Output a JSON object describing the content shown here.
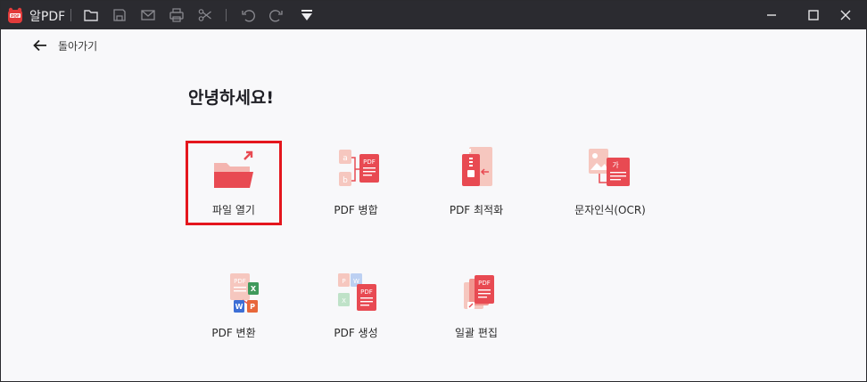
{
  "titlebar": {
    "app_name": "알PDF",
    "toolbar_icons": [
      "folder-icon",
      "save-icon",
      "mail-icon",
      "print-icon",
      "scissors-icon",
      "undo-icon",
      "redo-icon",
      "dropdown-icon"
    ],
    "window_controls": [
      "minimize-icon",
      "maximize-icon",
      "close-icon"
    ]
  },
  "back": {
    "label": "돌아가기"
  },
  "greeting": "안녕하세요!",
  "tiles": [
    {
      "label": "파일 열기",
      "icon": "open-file-icon"
    },
    {
      "label": "PDF 병합",
      "icon": "pdf-merge-icon"
    },
    {
      "label": "PDF 최적화",
      "icon": "pdf-optimize-icon"
    },
    {
      "label": "문자인식(OCR)",
      "icon": "ocr-icon"
    },
    {
      "label": "PDF 변환",
      "icon": "pdf-convert-icon"
    },
    {
      "label": "PDF 생성",
      "icon": "pdf-create-icon"
    },
    {
      "label": "일괄 편집",
      "icon": "batch-edit-icon"
    }
  ],
  "colors": {
    "accent": "#e84a52",
    "highlight": "#e4161d",
    "titlebar": "#2b2b30"
  }
}
